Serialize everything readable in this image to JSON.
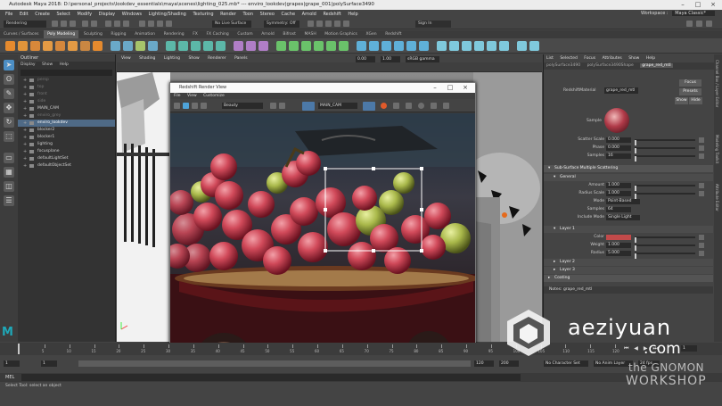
{
  "window": {
    "title": "Autodesk Maya 2018: D:\\personal_projects\\lookdev_essentials\\maya\\scenes\\lighting_025.mb* --- enviro_lookdev|grapes|grape_001|polySurface3490"
  },
  "menubar": {
    "items": [
      "File",
      "Edit",
      "Create",
      "Select",
      "Modify",
      "Display",
      "Windows",
      "Lighting/Shading",
      "Texturing",
      "Render",
      "Toon",
      "Stereo",
      "Cache",
      "Arnold",
      "Redshift",
      "Help"
    ],
    "workspace_label": "Workspace :",
    "workspace_value": "Maya Classic*"
  },
  "statusline": {
    "menuset": "Rendering",
    "live_surface": "No Live Surface",
    "symmetry": "Symmetry: Off",
    "sign_in": "Sign In"
  },
  "shelf": {
    "tabs": [
      "Curves / Surfaces",
      "Poly Modeling",
      "Sculpting",
      "Rigging",
      "Animation",
      "Rendering",
      "FX",
      "FX Caching",
      "Custom",
      "Arnold",
      "Bifrost",
      "MASH",
      "Motion Graphics",
      "XGen",
      "Redshift"
    ],
    "active_tab": "Poly Modeling"
  },
  "outliner": {
    "title": "Outliner",
    "menu": [
      "Display",
      "Show",
      "Help"
    ],
    "items": [
      {
        "label": "persp",
        "state": "dim"
      },
      {
        "label": "top",
        "state": "dim"
      },
      {
        "label": "front",
        "state": "dim"
      },
      {
        "label": "side",
        "state": "dim"
      },
      {
        "label": "MAIN_CAM",
        "state": "normal"
      },
      {
        "label": "enviro_grey",
        "state": "dim"
      },
      {
        "label": "enviro_lookdev",
        "state": "sel"
      },
      {
        "label": "blocker2",
        "state": "normal"
      },
      {
        "label": "blocker1",
        "state": "normal"
      },
      {
        "label": "lighting",
        "state": "normal"
      },
      {
        "label": "focusplane",
        "state": "normal"
      },
      {
        "label": "defaultLightSet",
        "state": "normal"
      },
      {
        "label": "defaultObjectSet",
        "state": "normal"
      }
    ]
  },
  "viewport": {
    "menu": [
      "View",
      "Shading",
      "Lighting",
      "Show",
      "Renderer",
      "Panels"
    ],
    "gamma_value": "0.00",
    "exposure_value": "1.00",
    "color_space": "sRGB gamma"
  },
  "render_view": {
    "title": "Redshift Render View",
    "menu": [
      "File",
      "View",
      "Customize"
    ],
    "aov": "Beauty",
    "camera": "MAIN_CAM"
  },
  "attribute_editor": {
    "menu": [
      "List",
      "Selected",
      "Focus",
      "Attributes",
      "Show",
      "Help"
    ],
    "tabs": [
      "polySurface3490",
      "polySurface3490Shape",
      "grape_red_mtl"
    ],
    "active_tab": "grape_red_mtl",
    "material_type_label": "RedshiftMaterial",
    "material_name": "grape_red_mtl",
    "buttons": {
      "focus": "Focus",
      "presets": "Presets",
      "show": "Show",
      "hide": "Hide"
    },
    "sample_label": "Sample",
    "scatter": [
      {
        "label": "Scatter Scale",
        "value": "0.000"
      },
      {
        "label": "Phase",
        "value": "0.000"
      },
      {
        "label": "Samples",
        "value": "16"
      }
    ],
    "sss_section": "Sub-Surface Multiple Scattering",
    "general_section": "General",
    "general": [
      {
        "label": "Amount",
        "value": "1.000"
      },
      {
        "label": "Radius Scale",
        "value": "1.000"
      },
      {
        "label": "Mode",
        "value": "Point-Based"
      },
      {
        "label": "Samples",
        "value": "64"
      },
      {
        "label": "Include Mode",
        "value": "Single Light"
      }
    ],
    "layer1_section": "Layer 1",
    "layer1": [
      {
        "label": "Color",
        "value": ""
      },
      {
        "label": "Weight",
        "value": "1.000"
      },
      {
        "label": "Radius",
        "value": "5.000"
      }
    ],
    "layer_color": "#c24a4a",
    "layer2": "Layer 2",
    "layer3": "Layer 3",
    "coating": "Coating",
    "notes": "Notes: grape_red_mtl"
  },
  "sidestrip": {
    "labels": [
      "Channel Box / Layer Editor",
      "Modeling Toolkit",
      "Attribute Editor"
    ]
  },
  "timeline": {
    "ticks": [
      "5",
      "10",
      "15",
      "20",
      "25",
      "30",
      "35",
      "40",
      "45",
      "50",
      "55",
      "60",
      "65",
      "70",
      "75",
      "80",
      "85",
      "90",
      "95",
      "100",
      "105",
      "110",
      "115",
      "120"
    ],
    "current_frame": "1",
    "range_start": "1",
    "range_start_field": "1",
    "range_end": "120",
    "anim_end": "120",
    "anim_end_field": "200",
    "character_set": "No Character Set",
    "anim_layer": "No Anim Layer",
    "fps": "24 fps"
  },
  "command_line": {
    "label": "MEL"
  },
  "help_line": {
    "text": "Select Tool: select an object"
  },
  "watermark": {
    "line1": "aeziyuan",
    "line2": ".com",
    "line3": "the GNOMON",
    "line4": "WORKSHOP"
  }
}
